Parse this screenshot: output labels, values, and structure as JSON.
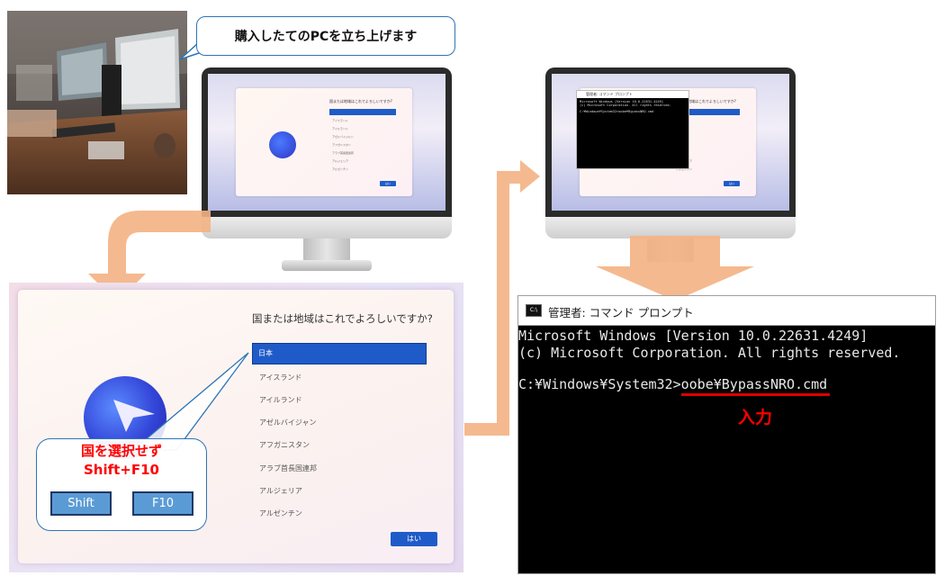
{
  "bubble": {
    "text": "購入したてのPCを立ち上げます"
  },
  "monitor1": {
    "question": "国または地域はこれでよろしいですか?",
    "items": [
      "日本",
      "アイスランド",
      "アイルランド",
      "アゼルバイジャン",
      "アフガニスタン",
      "アラブ首長国連邦",
      "アルジェリア",
      "アルゼンチン"
    ],
    "button": "はい"
  },
  "monitor2": {
    "cmd_title": "管理者: コマンド プロンプト",
    "cmd_lines": [
      "Microsoft Windows [Version 10.0.22631.4249]",
      "(c) Microsoft Corporation. All rights reserved.",
      "C:¥Windows¥System32>oobe¥BypassNRO.cmd"
    ],
    "behind_items": [
      "アルジェリア",
      "アルゼンチン"
    ],
    "button": "はい"
  },
  "oobe": {
    "question": "国または地域はこれでよろしいですか?",
    "selected": "日本",
    "items": [
      "アイスランド",
      "アイルランド",
      "アゼルバイジャン",
      "アフガニスタン",
      "アラブ首長国連邦",
      "アルジェリア",
      "アルゼンチン"
    ],
    "button": "はい"
  },
  "callout": {
    "line1": "国を選択せず",
    "line2": "Shift+F10",
    "key_shift": "Shift",
    "key_f10": "F10"
  },
  "cmd": {
    "icon_text": "C:\\",
    "title": "管理者: コマンド プロンプト",
    "line1": "Microsoft Windows [Version 10.0.22631.4249]",
    "line2": "(c) Microsoft Corporation. All rights reserved.",
    "prompt": "C:¥Windows¥System32>",
    "command": "oobe¥BypassNRO.cmd",
    "input_label": "入力"
  },
  "colors": {
    "accent_blue": "#1f5bc8",
    "annotation_red": "#ff0000",
    "arrow_orange": "#f4b183",
    "key_blue": "#5b9bd5"
  }
}
